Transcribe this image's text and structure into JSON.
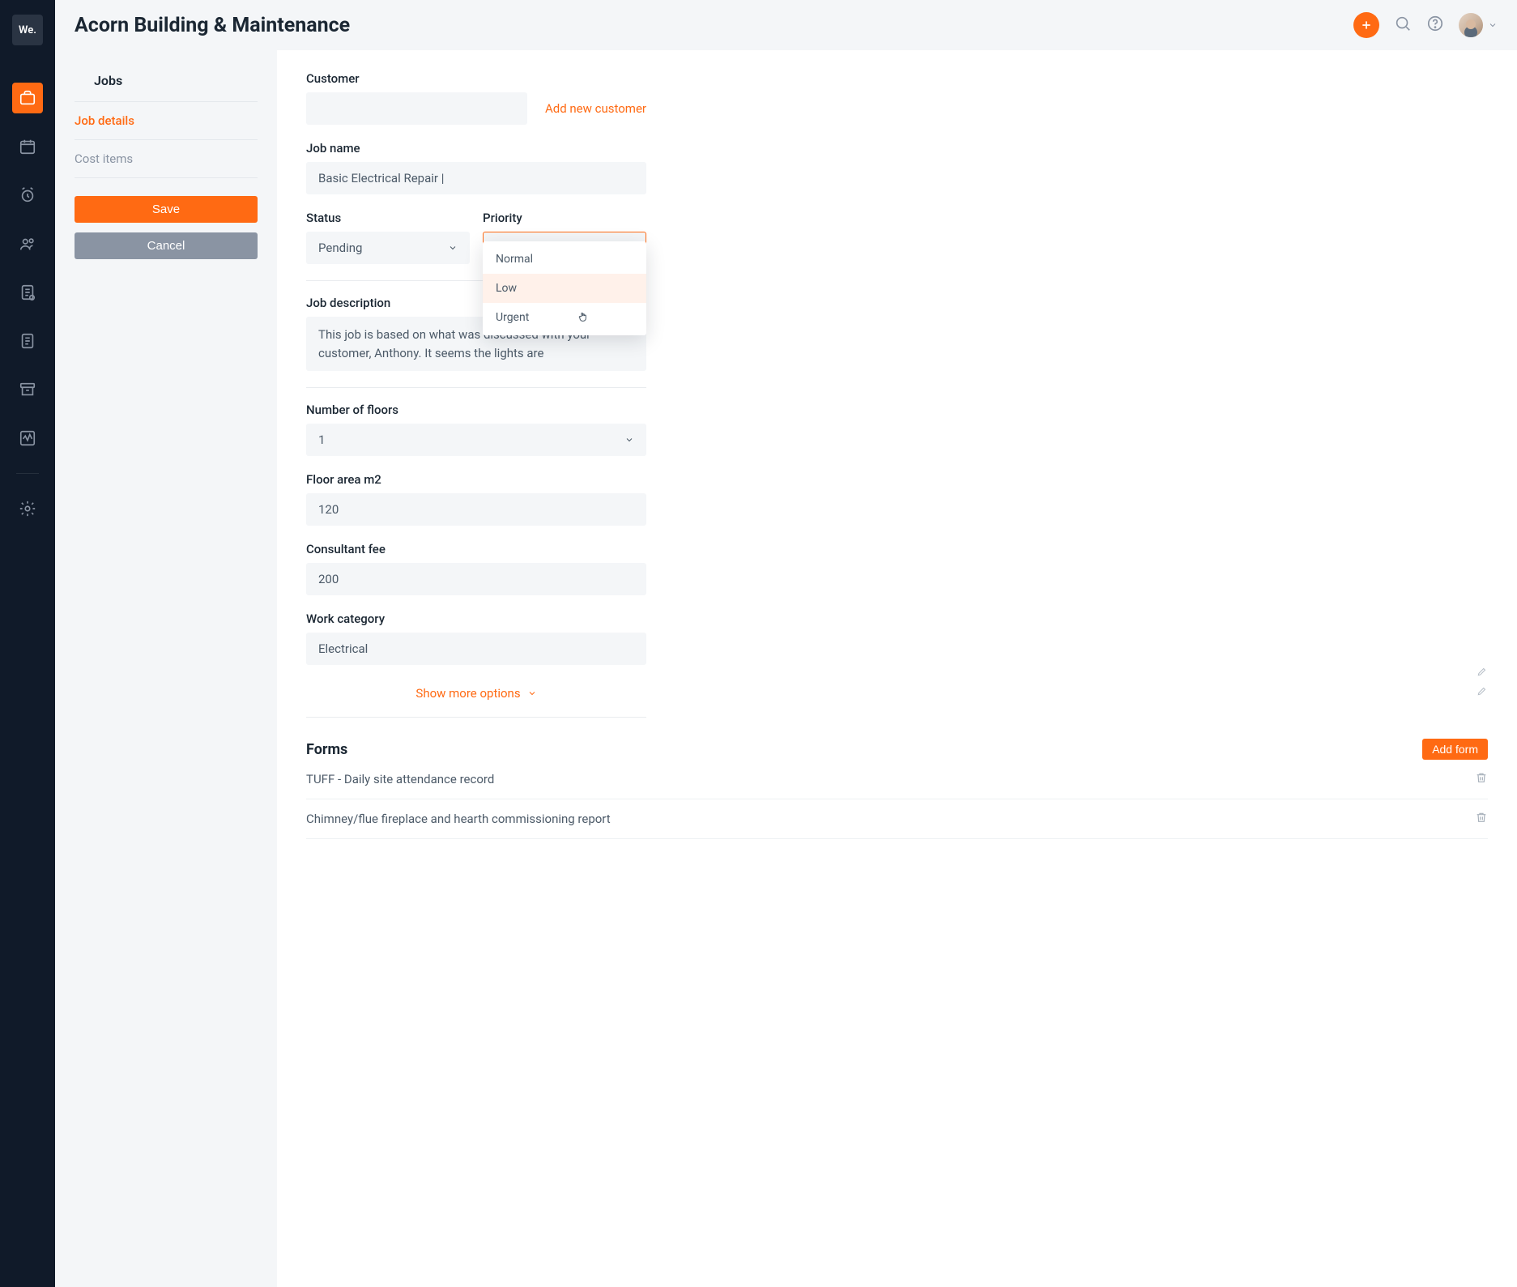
{
  "header": {
    "title": "Acorn Building & Maintenance"
  },
  "sidepanel": {
    "heading": "Jobs",
    "tabs": {
      "details": "Job details",
      "cost": "Cost items"
    },
    "save": "Save",
    "cancel": "Cancel"
  },
  "form": {
    "customer_label": "Customer",
    "add_customer": "Add new customer",
    "job_name_label": "Job name",
    "job_name_value": "Basic Electrical Repair |",
    "status_label": "Status",
    "status_value": "Pending",
    "priority_label": "Priority",
    "priority_value": "Normal",
    "priority_options": [
      "Normal",
      "Low",
      "Urgent"
    ],
    "description_label": "Job description",
    "description_value": "This job is based on what was discussed with your customer, Anthony. It seems the lights are",
    "floors_label": "Number of floors",
    "floors_value": "1",
    "area_label": "Floor area m2",
    "area_value": "120",
    "fee_label": "Consultant fee",
    "fee_value": "200",
    "category_label": "Work category",
    "category_value": "Electrical",
    "show_more": "Show more options"
  },
  "forms": {
    "heading": "Forms",
    "add": "Add form",
    "items": [
      "TUFF - Daily site attendance record",
      "Chimney/flue fireplace and hearth commissioning report"
    ]
  }
}
